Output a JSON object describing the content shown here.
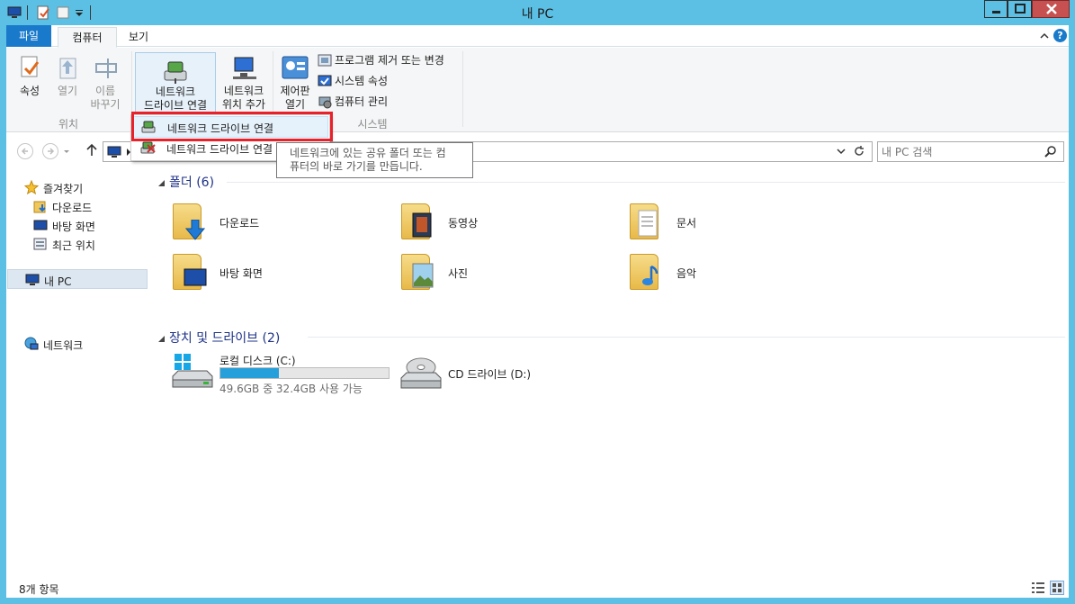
{
  "window": {
    "title": "내 PC"
  },
  "tabs": {
    "file": "파일",
    "computer": "컴퓨터",
    "view": "보기"
  },
  "ribbon": {
    "properties": "속성",
    "open": "열기",
    "rename_1": "이름",
    "rename_2": "바꾸기",
    "group_location": "위치",
    "map_drive_1": "네트워크",
    "map_drive_2": "드라이브 연결",
    "add_location_1": "네트워크",
    "add_location_2": "위치 추가",
    "control_panel_1": "제어판",
    "control_panel_2": "열기",
    "uninstall": "프로그램 제거 또는 변경",
    "system_props": "시스템 속성",
    "manage": "컴퓨터 관리",
    "group_system": "시스템"
  },
  "dropdown": {
    "items": [
      "네트워크 드라이브 연결",
      "네트워크 드라이브 연결 끊기"
    ],
    "tooltip_1": "네트워크에 있는 공유 폴더 또는 컴",
    "tooltip_2": "퓨터의 바로 가기를 만듭니다."
  },
  "search": {
    "placeholder": "내 PC 검색"
  },
  "nav": {
    "favorites": "즐겨찾기",
    "downloads": "다운로드",
    "desktop": "바탕 화면",
    "recent": "최근 위치",
    "this_pc": "내 PC",
    "network": "네트워크"
  },
  "folders": {
    "header": "폴더 (6)",
    "items": [
      "다운로드",
      "동영상",
      "문서",
      "바탕 화면",
      "사진",
      "음악"
    ]
  },
  "drives": {
    "header": "장치 및 드라이브 (2)",
    "c_name": "로컬 디스크 (C:)",
    "c_info": "49.6GB 중 32.4GB 사용 가능",
    "c_used_fraction": 0.347,
    "d_name": "CD 드라이브 (D:)"
  },
  "status": {
    "count": "8개 항목"
  },
  "colors": {
    "accent": "#1979ca",
    "frame": "#5bc0e4",
    "highlight": "#e8212a",
    "drive_bar": "#26a0da"
  }
}
